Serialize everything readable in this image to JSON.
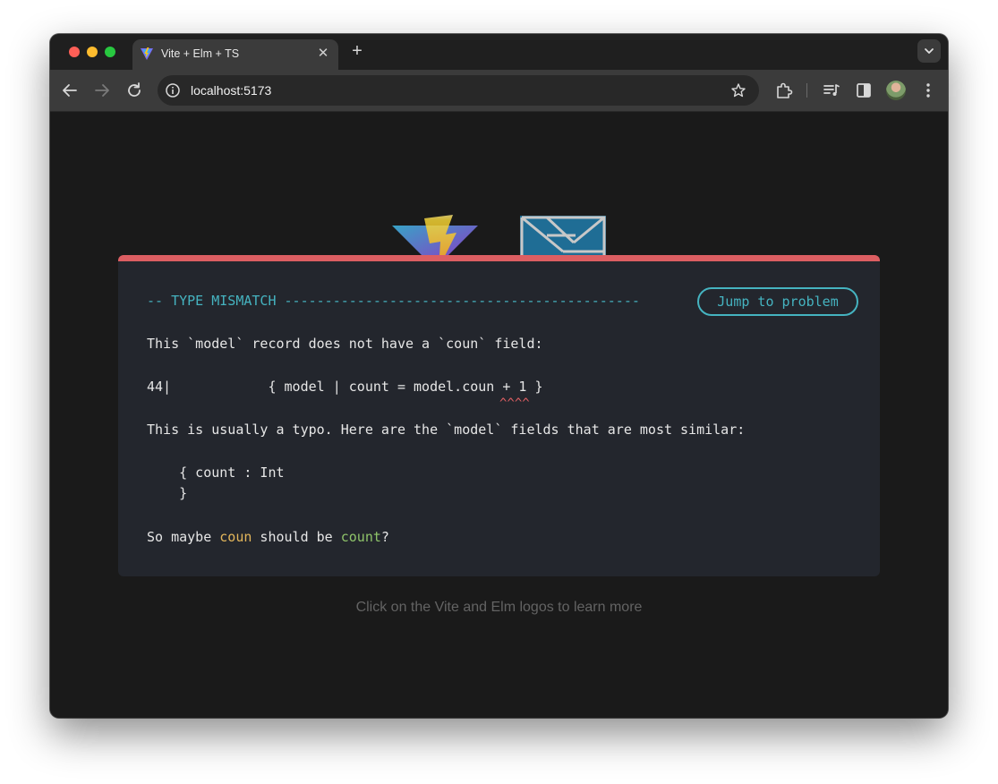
{
  "browser": {
    "tab_title": "Vite + Elm + TS",
    "tab_close": "✕",
    "new_tab": "+",
    "url": "localhost:5173"
  },
  "page": {
    "error": {
      "header": "-- TYPE MISMATCH --------------------------------------------",
      "jump_button": "Jump to problem",
      "line1": "This `model` record does not have a `coun` field:",
      "code_line": "44|            { model | count = model.coun + 1 }",
      "carets": "^^^^",
      "line2": "This is usually a typo. Here are the `model` fields that are most similar:",
      "suggest_open": "    { count : Int",
      "suggest_close": "    }",
      "maybe_prefix": "So maybe ",
      "maybe_wrong": "coun",
      "maybe_mid": " should be ",
      "maybe_right": "count",
      "maybe_suffix": "?"
    },
    "footer": "Click on the Vite and Elm logos to learn more"
  },
  "colors": {
    "accent_cyan": "#45b3c0",
    "error_red": "#dc5e62",
    "highlight_yellow": "#e3b65b",
    "highlight_green": "#8fc46a"
  }
}
